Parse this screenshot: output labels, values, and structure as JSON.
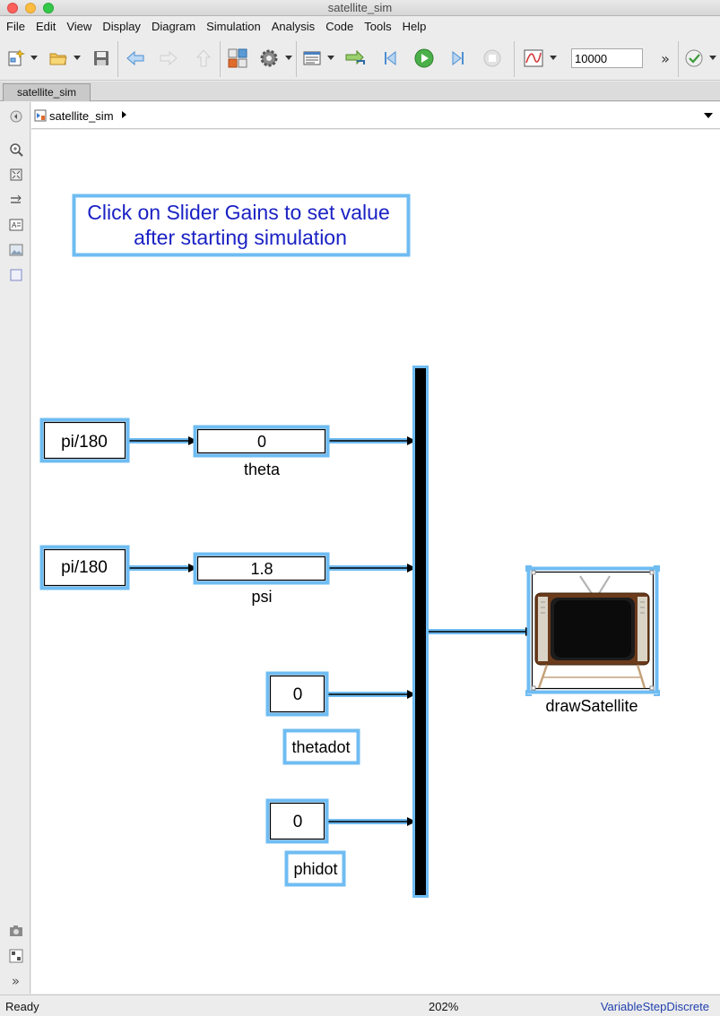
{
  "window": {
    "title": "satellite_sim"
  },
  "menu": [
    "File",
    "Edit",
    "View",
    "Display",
    "Diagram",
    "Simulation",
    "Analysis",
    "Code",
    "Tools",
    "Help"
  ],
  "toolbar": {
    "stop_time": "10000",
    "icons": [
      "new-model-icon",
      "open-folder-icon",
      "save-icon",
      "back-arrow-icon",
      "forward-arrow-icon",
      "up-arrow-icon",
      "library-browser-icon",
      "model-settings-gear-icon",
      "model-explorer-icon",
      "update-diagram-icon",
      "step-back-icon",
      "run-icon",
      "step-forward-icon",
      "stop-icon",
      "scope-icon",
      "more-icon",
      "check-icon"
    ]
  },
  "tab": {
    "label": "satellite_sim"
  },
  "breadcrumb": {
    "label": "satellite_sim"
  },
  "palette": [
    "hide-browser-icon",
    "zoom-in-icon",
    "fit-view-icon",
    "arrow-icon",
    "annotation-icon",
    "image-icon",
    "area-icon",
    "camera-icon",
    "model-browser-icon",
    "more-icon"
  ],
  "diagram": {
    "annotation_line1": "Click on Slider Gains to set value",
    "annotation_line2": "after starting simulation",
    "const_theta": "pi/180",
    "const_psi": "pi/180",
    "gain_theta_value": "0",
    "gain_theta_label": "theta",
    "gain_psi_value": "1.8",
    "gain_psi_label": "psi",
    "const_thetadot_value": "0",
    "label_thetadot": "thetadot",
    "const_phidot_value": "0",
    "label_phidot": "phidot",
    "subsystem_label": "drawSatellite"
  },
  "status": {
    "left": "Ready",
    "zoom": "202%",
    "solver": "VariableStepDiscrete"
  },
  "colors": {
    "highlight": "#6fbcf2",
    "annotation_text": "#1a21c4",
    "status_solver": "#1f3fae"
  }
}
